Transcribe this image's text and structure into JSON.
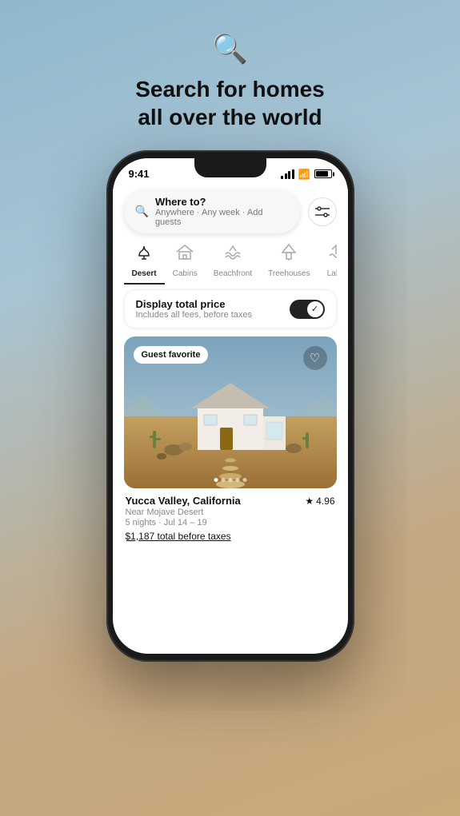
{
  "hero": {
    "title_line1": "Search for homes",
    "title_line2": "all over the world"
  },
  "status_bar": {
    "time": "9:41",
    "signal": "signal",
    "wifi": "wifi",
    "battery": "battery"
  },
  "search": {
    "primary": "Where to?",
    "secondary": "Anywhere · Any week · Add guests",
    "filter_label": "filter"
  },
  "categories": [
    {
      "id": "desert",
      "label": "Desert",
      "active": true
    },
    {
      "id": "cabins",
      "label": "Cabins",
      "active": false
    },
    {
      "id": "beachfront",
      "label": "Beachfront",
      "active": false
    },
    {
      "id": "treehouses",
      "label": "Treehouses",
      "active": false
    },
    {
      "id": "lake",
      "label": "Lake",
      "active": false
    }
  ],
  "price_toggle": {
    "title": "Display total price",
    "subtitle": "Includes all fees, before taxes",
    "enabled": true
  },
  "listing": {
    "badge": "Guest favorite",
    "location": "Yucca Valley, California",
    "sublocation": "Near Mojave Desert",
    "dates": "5 nights · Jul 14 – 19",
    "price": "$1,187 total before taxes",
    "rating": "4.96",
    "dots": [
      1,
      2,
      3,
      4,
      5
    ],
    "active_dot": 1
  }
}
